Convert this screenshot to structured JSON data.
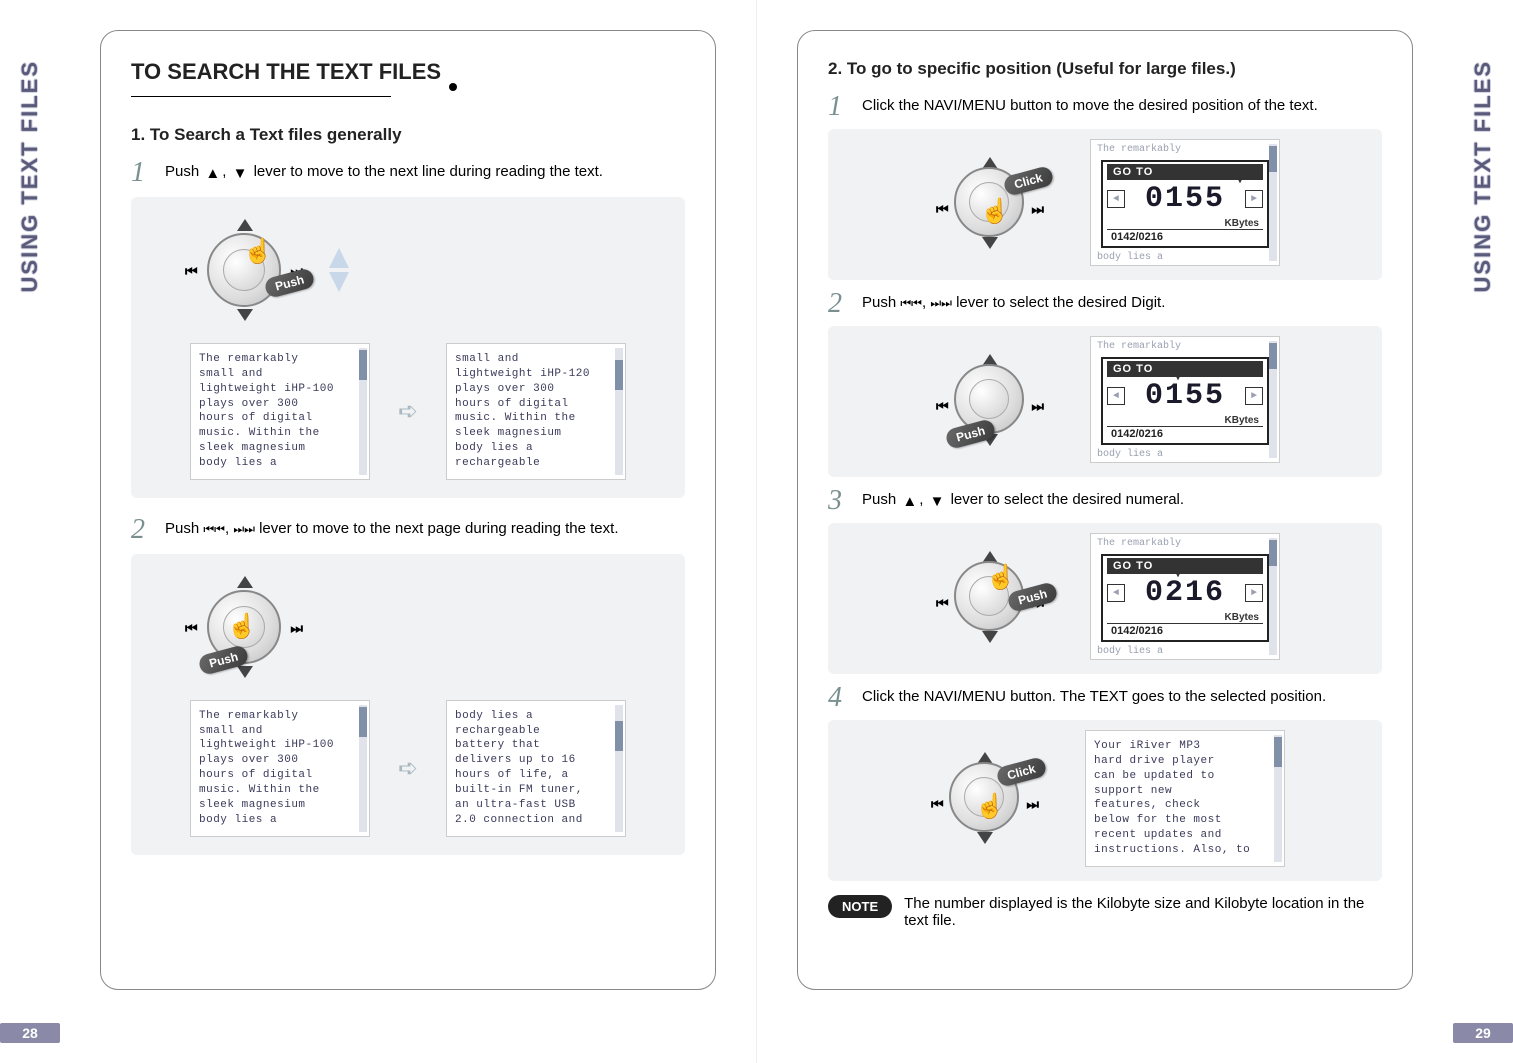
{
  "sideTab": "USING TEXT FILES",
  "pageLeft": "28",
  "pageRight": "29",
  "left": {
    "mainHeading": "TO SEARCH THE TEXT FILES",
    "sub1": "1. To Search a Text files generally",
    "step1": {
      "num": "1",
      "textA": "Push ",
      "textB": " lever to move to the next line during reading the text.",
      "action": "Push",
      "screenA": "The remarkably\nsmall and\nlightweight iHP-100\nplays over 300\nhours of digital\nmusic. Within the\nsleek magnesium\nbody lies a",
      "screenB": "small and\nlightweight iHP-120\nplays over 300\nhours of digital\nmusic. Within the\nsleek magnesium\nbody lies a\nrechargeable"
    },
    "step2": {
      "num": "2",
      "textA": "Push ",
      "textB": " lever to move to the next page during reading the text.",
      "action": "Push",
      "screenA": "The remarkably\nsmall and\nlightweight iHP-100\nplays over 300\nhours of digital\nmusic. Within the\nsleek magnesium\nbody lies a",
      "screenB": " body lies a\nrechargeable\nbattery that\ndelivers up to 16\nhours of life, a\nbuilt-in FM tuner,\nan ultra-fast USB\n2.0 connection and"
    }
  },
  "right": {
    "sub2": "2. To go to specific position (Useful for large files.)",
    "step1": {
      "num": "1",
      "text": "Click the NAVI/MENU button to move the desired position of the text.",
      "action": "Click",
      "goto": {
        "header": "GO TO",
        "digits": "0155",
        "kbytes": "KBytes",
        "progress": "0142/0216",
        "bg": "The remarkably",
        "footer": "body lies a"
      }
    },
    "step2": {
      "num": "2",
      "textA": "Push ",
      "textB": " lever to select the desired Digit.",
      "action": "Push",
      "goto": {
        "header": "GO TO",
        "digits": "0155",
        "kbytes": "KBytes",
        "progress": "0142/0216",
        "bg": "The remarkably",
        "footer": "body lies a"
      }
    },
    "step3": {
      "num": "3",
      "textA": "Push ",
      "textB": " lever to select the desired numeral.",
      "action": "Push",
      "goto": {
        "header": "GO TO",
        "digits": "0216",
        "kbytes": "KBytes",
        "progress": "0142/0216",
        "bg": "The remarkably",
        "footer": "body lies a"
      }
    },
    "step4": {
      "num": "4",
      "text": "Click the NAVI/MENU button. The TEXT goes to the selected position.",
      "action": "Click",
      "screen": "Your iRiver MP3\nhard drive player\ncan be updated to\nsupport new\nfeatures, check\nbelow for the most\nrecent updates and\ninstructions. Also, to"
    },
    "noteLabel": "NOTE",
    "noteText": "The number displayed is the Kilobyte size and Kilobyte location in the text file."
  }
}
